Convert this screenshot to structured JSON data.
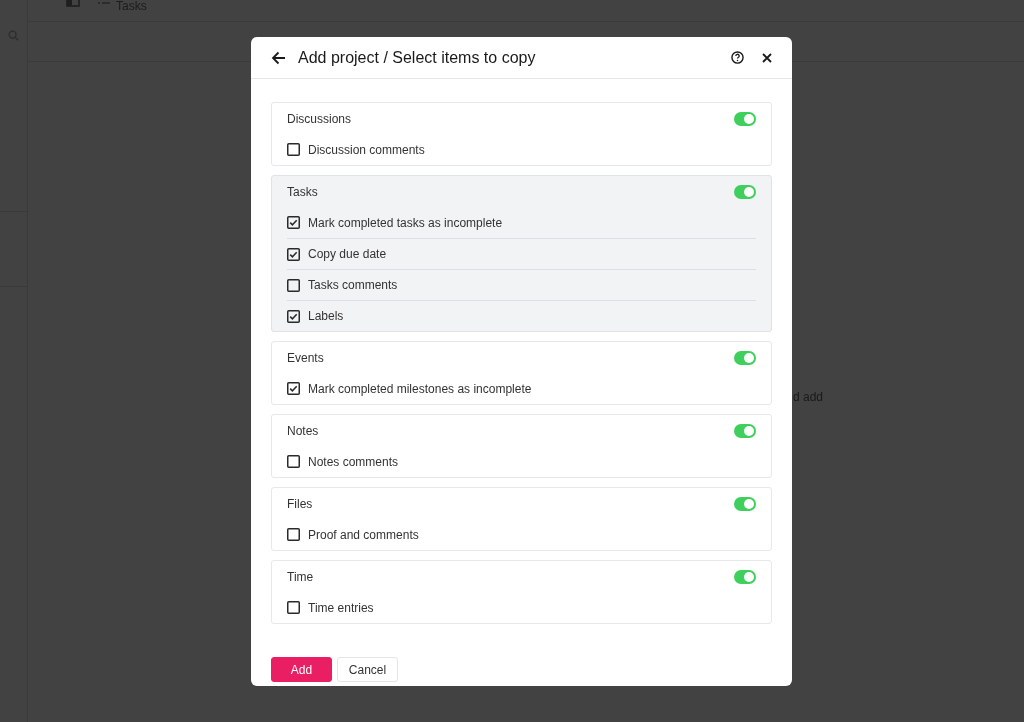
{
  "background": {
    "tab_label": "Tasks",
    "hint_text": "d add"
  },
  "dialog": {
    "title": "Add project / Select items to copy",
    "sections": [
      {
        "title": "Discussions",
        "on": true,
        "highlighted": false,
        "options": [
          {
            "label": "Discussion comments",
            "checked": false
          }
        ]
      },
      {
        "title": "Tasks",
        "on": true,
        "highlighted": true,
        "options": [
          {
            "label": "Mark completed tasks as incomplete",
            "checked": true
          },
          {
            "label": "Copy due date",
            "checked": true
          },
          {
            "label": "Tasks comments",
            "checked": false
          },
          {
            "label": "Labels",
            "checked": true
          }
        ]
      },
      {
        "title": "Events",
        "on": true,
        "highlighted": false,
        "options": [
          {
            "label": "Mark completed milestones as incomplete",
            "checked": true
          }
        ]
      },
      {
        "title": "Notes",
        "on": true,
        "highlighted": false,
        "options": [
          {
            "label": "Notes comments",
            "checked": false
          }
        ]
      },
      {
        "title": "Files",
        "on": true,
        "highlighted": false,
        "options": [
          {
            "label": "Proof and comments",
            "checked": false
          }
        ]
      },
      {
        "title": "Time",
        "on": true,
        "highlighted": false,
        "options": [
          {
            "label": "Time entries",
            "checked": false
          }
        ]
      }
    ],
    "buttons": [
      {
        "label": "Add",
        "kind": "primary"
      },
      {
        "label": "Cancel",
        "kind": "secondary"
      }
    ]
  }
}
